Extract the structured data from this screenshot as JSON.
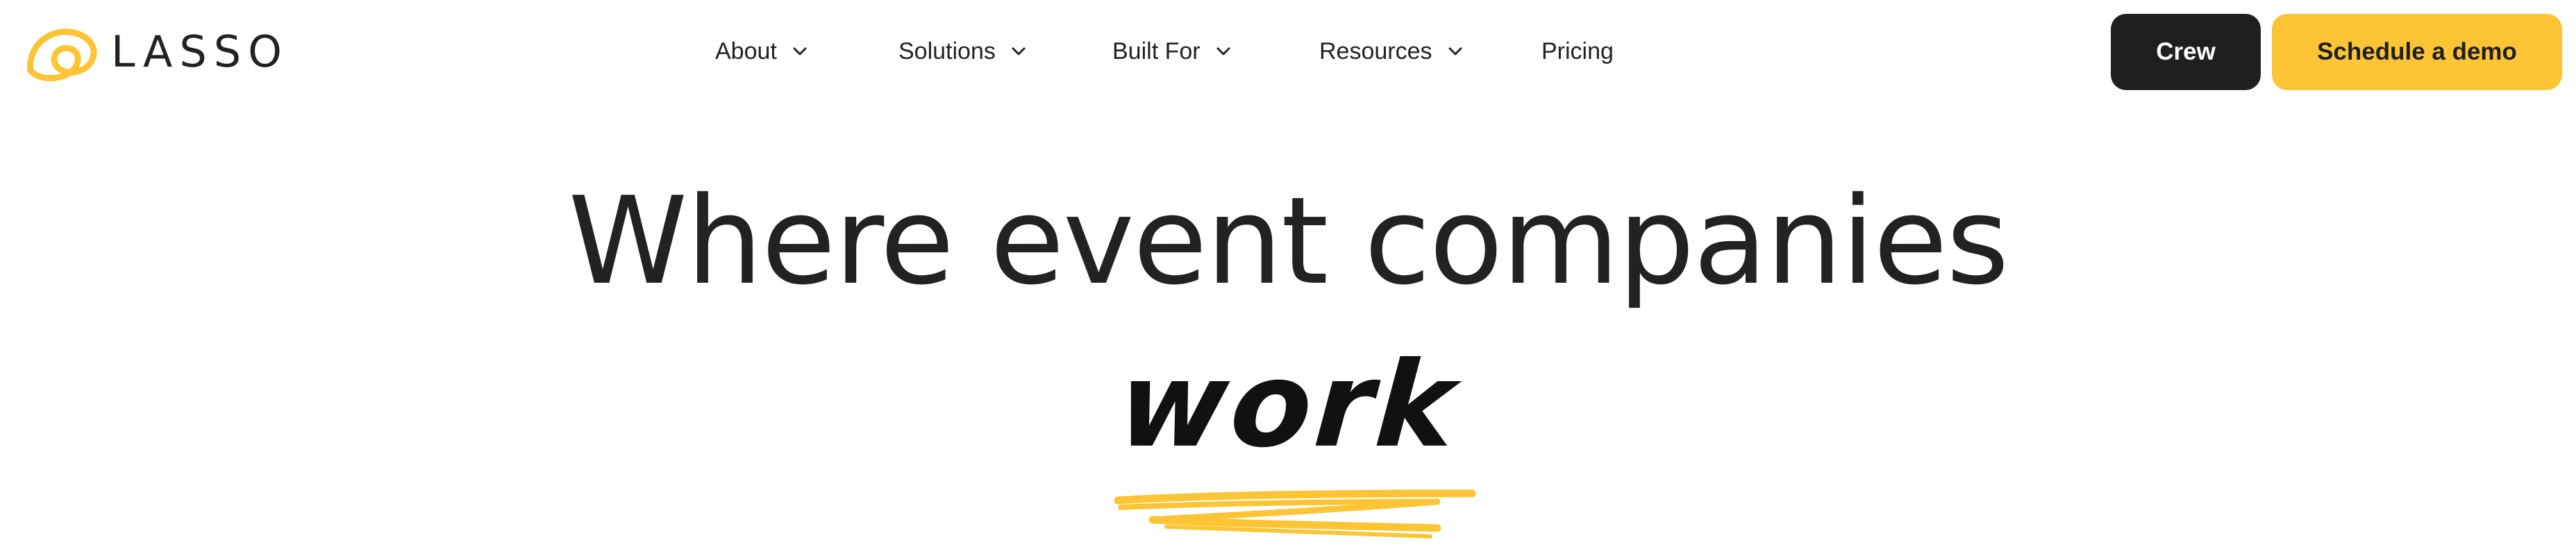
{
  "brand": {
    "logo_text": "LASSO",
    "logo_mark_icon": "lasso-loop-icon",
    "accent_color": "#fdc535",
    "dark_color": "#1f1f1f"
  },
  "nav": {
    "items": [
      {
        "label": "About",
        "has_dropdown": true
      },
      {
        "label": "Solutions",
        "has_dropdown": true
      },
      {
        "label": "Built For",
        "has_dropdown": true
      },
      {
        "label": "Resources",
        "has_dropdown": true
      },
      {
        "label": "Pricing",
        "has_dropdown": false
      }
    ],
    "dropdown_icon": "chevron-down-icon"
  },
  "actions": {
    "crew_label": "Crew",
    "demo_label": "Schedule a demo"
  },
  "hero": {
    "title": "Where event companies",
    "accent_word": "work"
  }
}
